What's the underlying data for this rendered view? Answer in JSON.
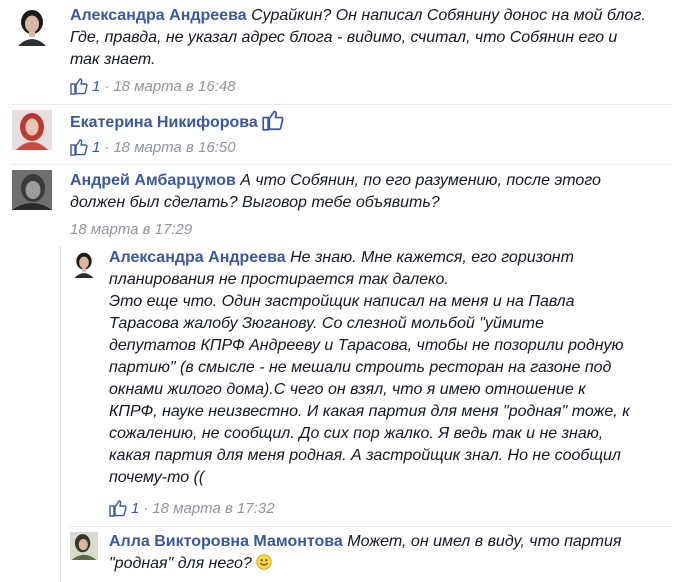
{
  "comments": [
    {
      "author": "Александра Андреева",
      "text_lines": [
        "Сурайкин? Он написал Собянину донос на мой блог.",
        "Где, правда, не указал адрес блога - видимо, считал, что Собянин его и",
        "так знает."
      ],
      "likes": "1",
      "separator": "·",
      "time": "18 марта в 16:48"
    },
    {
      "author": "Екатерина Никифорова",
      "likes": "1",
      "separator": "·",
      "time": "18 марта в 16:50"
    },
    {
      "author": "Андрей Амбарцумов",
      "text_lines": [
        "А что Собянин, по его разумению, после этого",
        "должен был сделать? Выговор тебе объявить?"
      ],
      "time": "18 марта в 17:29"
    }
  ],
  "replies": [
    {
      "author": "Александра Андреева",
      "text_lines": [
        "Не знаю. Мне кажется, его горизонт",
        "планирования не простирается так далеко.",
        "Это еще что. Один застройщик написал на меня и на Павла",
        "Тарасова жалобу Зюганову. Со слезной мольбой \"уймите",
        "депутатов КПРФ Андрееву и Тарасова, чтобы не позорили родную",
        "партию\" (в смысле - не мешали строить ресторан на газоне под",
        "окнами жилого дома).С чего он взял, что я имею отношение к",
        "КПРФ, науке неизвестно. И какая партия для меня \"родная\" тоже, к",
        "сожалению, не сообщил. До сих пор жалко. Я ведь так и не знаю,",
        "какая партия для меня родная. А застройщик знал. Но не сообщил",
        "почему-то (("
      ],
      "likes": "1",
      "separator": "·",
      "time": "18 марта в 17:32"
    },
    {
      "author": "Алла Викторовна Мамонтова",
      "text_lines": [
        "Может, он имел в виду, что партия",
        "\"родная\" для него?"
      ]
    }
  ],
  "colors": {
    "link": "#3b5998",
    "text": "#141823",
    "meta": "#90949c"
  },
  "icons": [
    "like-icon",
    "smile-emoji-icon"
  ]
}
